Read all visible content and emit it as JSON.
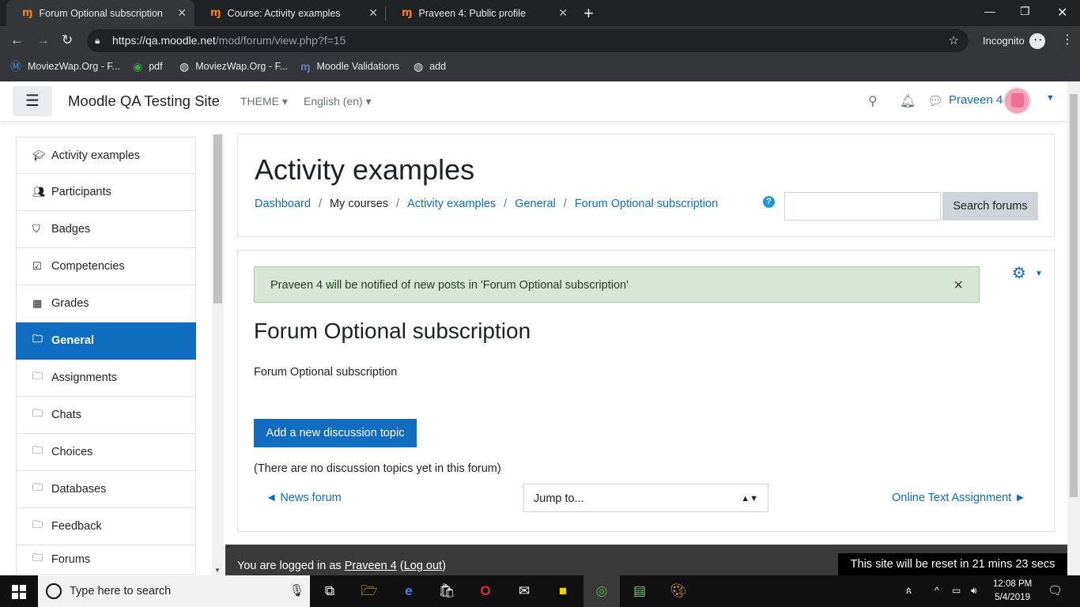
{
  "browser": {
    "tabs": [
      {
        "label": "Forum Optional subscription",
        "active": true
      },
      {
        "label": "Course: Activity examples",
        "active": false
      },
      {
        "label": "Praveen 4: Public profile",
        "active": false
      }
    ],
    "url_host": "https://qa.moodle.net",
    "url_path": "/mod/forum/view.php?f=15",
    "incognito_label": "Incognito",
    "bookmarks": [
      "MoviezWap.Org - F...",
      "pdf",
      "MoviezWap.Org - F...",
      "Moodle Validations",
      "add"
    ]
  },
  "header": {
    "site_name": "Moodle QA Testing Site",
    "theme_menu": "THEME",
    "language_menu": "English (en)",
    "user_name": "Praveen 4"
  },
  "sidebar": {
    "items": [
      {
        "label": "Activity examples",
        "icon": "graduation-cap-icon"
      },
      {
        "label": "Participants",
        "icon": "users-icon"
      },
      {
        "label": "Badges",
        "icon": "shield-icon"
      },
      {
        "label": "Competencies",
        "icon": "checkbox-icon"
      },
      {
        "label": "Grades",
        "icon": "table-icon"
      },
      {
        "label": "General",
        "icon": "folder-icon",
        "active": true
      },
      {
        "label": "Assignments",
        "icon": "folder-icon"
      },
      {
        "label": "Chats",
        "icon": "folder-icon"
      },
      {
        "label": "Choices",
        "icon": "folder-icon"
      },
      {
        "label": "Databases",
        "icon": "folder-icon"
      },
      {
        "label": "Feedback",
        "icon": "folder-icon"
      },
      {
        "label": "Forums",
        "icon": "folder-icon"
      }
    ]
  },
  "page": {
    "title": "Activity examples",
    "breadcrumb": [
      "Dashboard",
      "My courses",
      "Activity examples",
      "General",
      "Forum Optional subscription"
    ],
    "search_button": "Search forums",
    "search_placeholder": ""
  },
  "main": {
    "alert": "Praveen 4 will be notified of new posts in 'Forum Optional subscription'",
    "alert_close": "×",
    "forum_title": "Forum Optional subscription",
    "forum_description": "Forum Optional subscription",
    "add_button": "Add a new discussion topic",
    "no_discussions": "(There are no discussion topics yet in this forum)",
    "prev_link": "◄ News forum",
    "next_link": "Online Text Assignment ►",
    "jump_to": "Jump to..."
  },
  "footer": {
    "logged_in_prefix": "You are logged in as ",
    "user_link": "Praveen 4",
    "logout_link": "Log out",
    "reset_notice": "This site will be reset in 21 mins 23 secs"
  },
  "taskbar": {
    "search_placeholder": "Type here to search",
    "time": "12:08 PM",
    "date": "5/4/2019"
  },
  "colors": {
    "accent": "#0f6cbf",
    "alert_bg": "#d7e6d7",
    "footer_bg": "#3a3a3a"
  }
}
